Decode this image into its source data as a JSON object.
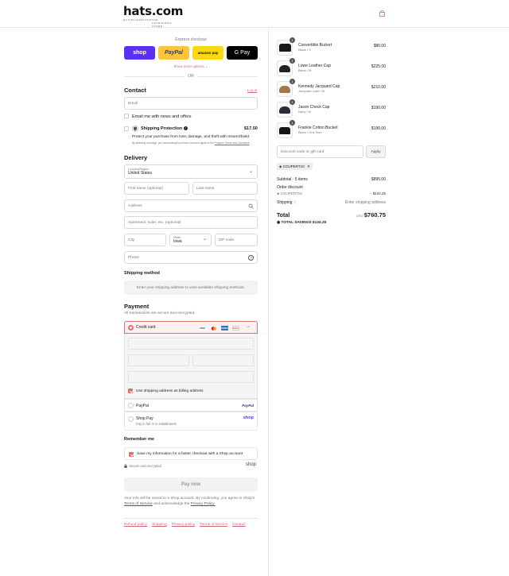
{
  "brand": {
    "name": "hats.com",
    "tagline": [
      "ESTABLISHED",
      "1995",
      "THE HATMAKER'S STORE"
    ]
  },
  "express": {
    "title": "Express checkout",
    "buttons": {
      "shop": "shop",
      "paypal": "PayPal",
      "amazon": "amazon pay",
      "gpay": "G Pay"
    },
    "show_more": "Show more options",
    "or": "OR"
  },
  "contact": {
    "heading": "Contact",
    "login_link": "Log in",
    "email_placeholder": "Email",
    "news_label": "Email me with news and offers"
  },
  "protection": {
    "title": "Shipping Protection",
    "price": "$17.50",
    "desc": "Protect your purchase from loss, damage, and theft with InsureShield.",
    "fine_print": "By selecting coverage, you acknowledge you have read and agree to the",
    "fine_link": "Program Terms and Conditions"
  },
  "delivery": {
    "heading": "Delivery",
    "country_label": "Country/Region",
    "country_value": "United States",
    "first_name": "First name (optional)",
    "last_name": "Last name",
    "address": "Address",
    "apartment": "Apartment, suite, etc. (optional)",
    "city": "City",
    "state_label": "State",
    "state_value": "Iowa",
    "zip": "ZIP code",
    "phone": "Phone"
  },
  "shipping_method": {
    "heading": "Shipping method",
    "message": "Enter your shipping address to view available shipping methods."
  },
  "payment": {
    "heading": "Payment",
    "subtitle": "All transactions are secure and encrypted.",
    "credit_card": "Credit card",
    "card_brands": [
      "VISA",
      "MC",
      "AMEX",
      "DISC"
    ],
    "billing_label": "Use shipping address as billing address",
    "paypal": "PayPal",
    "shop_pay": "Shop Pay",
    "shop_pay_sub": "Pay in full or in installments",
    "paypal_logo": "PayPal",
    "shop_logo": "shop"
  },
  "remember": {
    "heading": "Remember me",
    "save_label": "Save my information for a faster checkout with a Shop account",
    "secure": "Secure and encrypted",
    "shop_logo": "shop"
  },
  "pay_now": "Pay now",
  "legal": {
    "text1": "Your info will be saved to a Shop account. By continuing, you agree to Shop's",
    "terms": "Terms of Service",
    "text2": "and acknowledge the",
    "privacy": "Privacy Policy."
  },
  "footer_links": [
    "Refund policy",
    "Shipping",
    "Privacy policy",
    "Terms of service",
    "Contact"
  ],
  "cart": {
    "items": [
      {
        "qty": "1",
        "name": "Convertible Bucket",
        "variant": "Black / S",
        "price": "$80.00",
        "hat_color": "#1a1a1a"
      },
      {
        "qty": "1",
        "name": "Lowe Leather Cap",
        "variant": "Black / M",
        "price": "$225.00",
        "hat_color": "#222222"
      },
      {
        "qty": "1",
        "name": "Kennedy Jacquard Cap",
        "variant": "Jacquard Lotte / M",
        "price": "$210.00",
        "hat_color": "#a0784a"
      },
      {
        "qty": "1",
        "name": "Jason Check Cap",
        "variant": "Navy / M",
        "price": "$190.00",
        "hat_color": "#2b2b33"
      },
      {
        "qty": "1",
        "name": "Frankie Cotton Bucket",
        "variant": "Black / One Size",
        "price": "$190.00",
        "hat_color": "#151515"
      }
    ],
    "discount_placeholder": "Discount code or gift card",
    "apply": "Apply",
    "code_chip": "COUPERT10",
    "subtotal_label": "Subtotal · 5 items",
    "subtotal": "$895.00",
    "order_discount": "Order discount",
    "discount_code": "COUPERT10",
    "discount_value": "- $134.25",
    "shipping_label": "Shipping",
    "shipping_value": "Enter shipping address",
    "total_label": "Total",
    "currency": "USD",
    "total": "$760.75",
    "savings_label": "TOTAL SAVINGS",
    "savings": "$134.25"
  }
}
